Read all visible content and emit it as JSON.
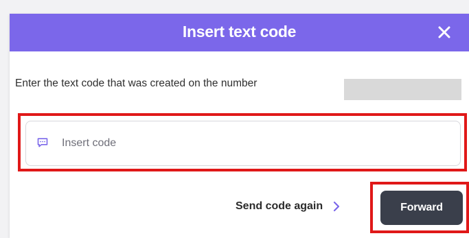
{
  "dialog": {
    "title": "Insert text code",
    "close_icon": "close-icon"
  },
  "instruction": {
    "text": "Enter the text code that was created on the number"
  },
  "code_input": {
    "placeholder": "Insert code",
    "value": "",
    "icon": "message-icon"
  },
  "actions": {
    "resend_label": "Send code again",
    "resend_icon": "chevron-right-icon",
    "forward_label": "Forward"
  },
  "colors": {
    "header_background": "#7b67ea",
    "accent": "#7b67ea",
    "primary_button": "#3a3f4b",
    "highlight_border": "#e01818",
    "redaction": "#d9d9d9"
  }
}
